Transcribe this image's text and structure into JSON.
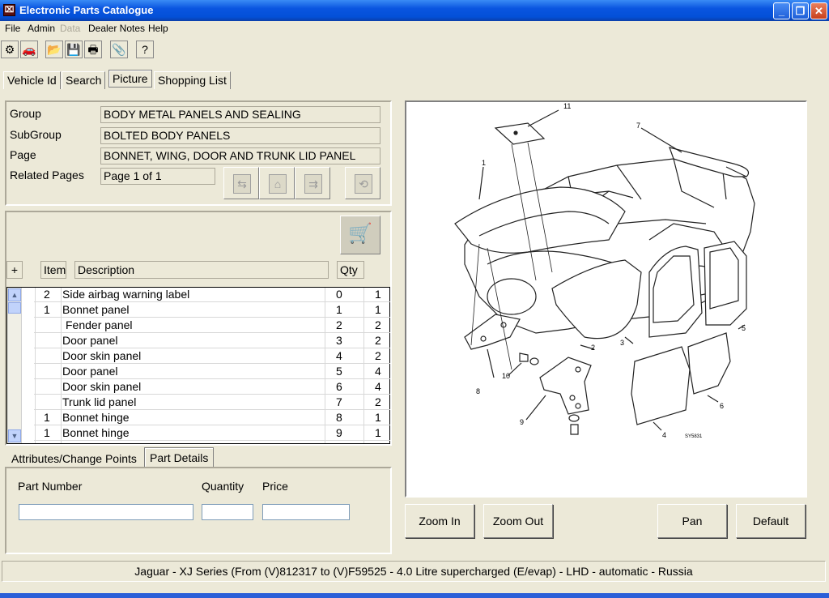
{
  "window": {
    "title": "Electronic Parts Catalogue",
    "icon_glyph": "⌧",
    "minimize": "_",
    "maximize": "❐",
    "close": "✕"
  },
  "menu": [
    "File",
    "Admin",
    "Data",
    "Dealer Notes",
    "Help"
  ],
  "toolbar_icons": [
    "⚙",
    "🚗",
    "📂",
    "💾",
    "🖶",
    "📎",
    "?"
  ],
  "tabs": [
    "Vehicle Id",
    "Search",
    "Picture",
    "Shopping List"
  ],
  "info": {
    "group_label": "Group",
    "group_value": "BODY METAL PANELS AND SEALING",
    "subgroup_label": "SubGroup",
    "subgroup_value": "BOLTED BODY PANELS",
    "page_label": "Page",
    "page_value": "BONNET, WING, DOOR AND TRUNK LID PANEL",
    "related_label": "Related Pages",
    "related_value": "Page 1 of 1",
    "nav_glyphs": [
      "⇆",
      "⌂",
      "⇉",
      "⟲"
    ]
  },
  "cart_glyph": "🛒",
  "columns": {
    "plus": "+",
    "item": "Item",
    "description": "Description",
    "qty": "Qty"
  },
  "rows": [
    {
      "level": "2",
      "desc": "Side airbag warning label",
      "item": "0",
      "qty": "1"
    },
    {
      "level": "1",
      "desc": "Bonnet panel",
      "item": "1",
      "qty": "1"
    },
    {
      "level": "",
      "desc": "Fender panel",
      "item": "2",
      "qty": "2"
    },
    {
      "level": "",
      "desc": "Door panel",
      "item": "3",
      "qty": "2"
    },
    {
      "level": "",
      "desc": "Door skin panel",
      "item": "4",
      "qty": "2"
    },
    {
      "level": "",
      "desc": "Door panel",
      "item": "5",
      "qty": "4"
    },
    {
      "level": "",
      "desc": "Door skin panel",
      "item": "6",
      "qty": "4"
    },
    {
      "level": "",
      "desc": "Trunk lid panel",
      "item": "7",
      "qty": "2"
    },
    {
      "level": "1",
      "desc": "Bonnet hinge",
      "item": "8",
      "qty": "1"
    },
    {
      "level": "1",
      "desc": "Bonnet hinge",
      "item": "9",
      "qty": "1"
    }
  ],
  "scroll": {
    "up": "▲",
    "down": "▼"
  },
  "detail_tabs": [
    "Attributes/Change Points",
    "Part Details"
  ],
  "details": {
    "part_number": "Part Number",
    "quantity": "Quantity",
    "price": "Price"
  },
  "diagram": {
    "callouts": [
      "11",
      "7",
      "1",
      "2",
      "3",
      "5",
      "8",
      "10",
      "9",
      "6",
      "4"
    ],
    "ref": "SY5831"
  },
  "buttons": {
    "zoom_in": "Zoom In",
    "zoom_out": "Zoom Out",
    "pan": "Pan",
    "default": "Default"
  },
  "status": "Jaguar - XJ Series (From (V)812317 to (V)F59525 - 4.0 Litre supercharged (E/evap) - LHD - automatic - Russia"
}
